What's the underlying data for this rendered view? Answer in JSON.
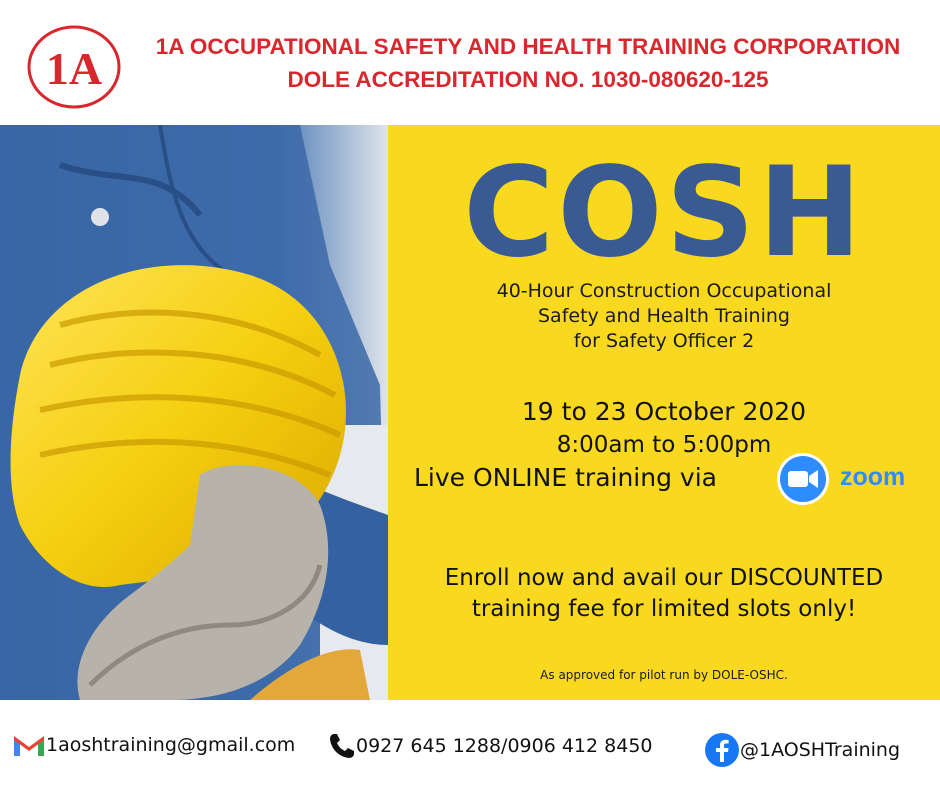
{
  "header": {
    "logo_text": "1A",
    "org_name": "1A OCCUPATIONAL SAFETY AND HEALTH TRAINING CORPORATION",
    "accreditation": "DOLE ACCREDITATION NO. 1030-080620-125"
  },
  "poster": {
    "title": "COSH",
    "subtitle_lines": [
      "40-Hour Construction Occupational",
      "Safety and Health Training",
      "for Safety Officer 2"
    ],
    "date": "19 to 23 October 2020",
    "time": "8:00am to 5:00pm",
    "delivery": "Live ONLINE training via",
    "platform": "zoom",
    "enroll_lines": [
      "Enroll now and avail our DISCOUNTED",
      "training fee for limited slots only!"
    ],
    "approval_note": "As approved for pilot run by DOLE-OSHC."
  },
  "footer": {
    "email": "1aoshtraining@gmail.com",
    "phones": "0927 645 1288/0906 412 8450",
    "facebook": "@1AOSHTraining"
  },
  "icons": {
    "email": "gmail-icon",
    "phone": "phone-icon",
    "facebook": "facebook-icon",
    "zoom": "zoom-icon"
  },
  "colors": {
    "brand_red": "#d8272d",
    "panel_yellow": "#f9d91f",
    "title_blue": "#3a5a94",
    "zoom_blue": "#2d8cff",
    "facebook_blue": "#1877f2"
  }
}
